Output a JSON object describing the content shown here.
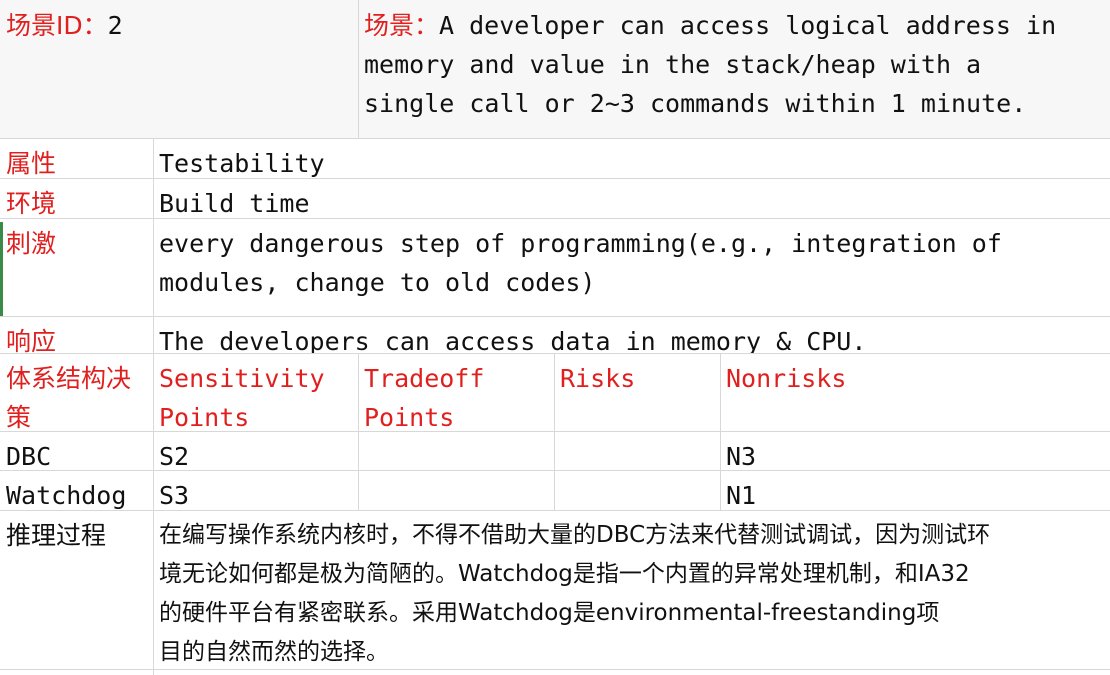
{
  "scenario": {
    "id_label": "场景ID：",
    "id_value": "2",
    "desc_label": "场景：",
    "desc_lines": [
      "A developer can access logical address in",
      "memory and value in the stack/heap with a",
      "single call or 2~3 commands within 1 minute."
    ]
  },
  "attribute": {
    "label": "属性",
    "value": "Testability"
  },
  "environment": {
    "label": "环境",
    "value": "Build time"
  },
  "stimulus": {
    "label": "刺激",
    "lines": [
      "every dangerous step of programming(e.g., integration of",
      "modules, change to old codes)"
    ]
  },
  "response": {
    "label": "响应",
    "value": "The developers can access data in memory & CPU."
  },
  "decisions": {
    "label_lines": [
      "体系结构决",
      "策"
    ],
    "headers": [
      [
        "Sensitivity",
        "Points"
      ],
      [
        "Tradeoff",
        "Points"
      ],
      [
        "Risks"
      ],
      [
        "Nonrisks"
      ]
    ],
    "rows": [
      {
        "name": "DBC",
        "sensitivity": "S2",
        "tradeoff": "",
        "risks": "",
        "nonrisks": "N3"
      },
      {
        "name": "Watchdog",
        "sensitivity": "S3",
        "tradeoff": "",
        "risks": "",
        "nonrisks": "N1"
      }
    ]
  },
  "reasoning": {
    "label": "推理过程",
    "lines": [
      "在编写操作系统内核时，不得不借助大量的DBC方法来代替测试调试，因为测试环",
      "境无论如何都是极为简陋的。Watchdog是指一个内置的异常处理机制，和IA32",
      "的硬件平台有紧密联系。采用Watchdog是environmental-freestanding项",
      "目的自然而然的选择。"
    ]
  },
  "colors": {
    "label_red": "#e0201f",
    "text": "#111111",
    "grid": "#d8d8d8",
    "selection_edge": "#3a8a48"
  }
}
